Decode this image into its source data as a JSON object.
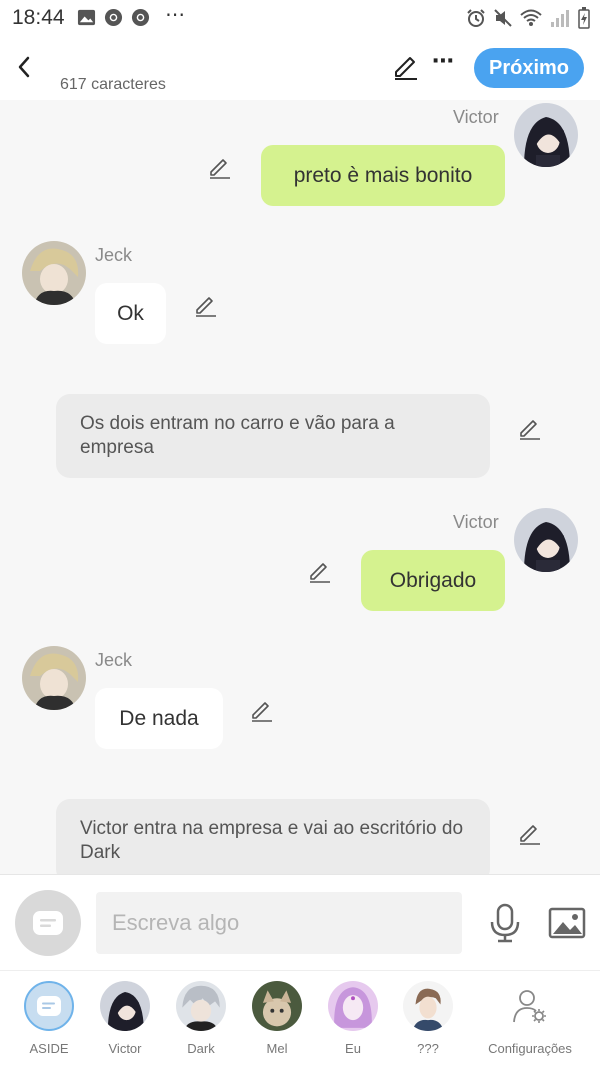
{
  "status_bar": {
    "time": "18:44",
    "more": "⋯"
  },
  "header": {
    "char_count": "617 caracteres",
    "next_label": "Próximo",
    "more": "⋯"
  },
  "messages": [
    {
      "type": "char",
      "side": "right",
      "name": "Victor",
      "text": "preto è mais bonito"
    },
    {
      "type": "char",
      "side": "left",
      "name": "Jeck",
      "text": "Ok"
    },
    {
      "type": "narration",
      "text": "Os dois entram no carro e vão para a empresa"
    },
    {
      "type": "char",
      "side": "right",
      "name": "Victor",
      "text": "Obrigado"
    },
    {
      "type": "char",
      "side": "left",
      "name": "Jeck",
      "text": "De nada"
    },
    {
      "type": "narration",
      "text": "Victor entra na empresa e vai ao escritório do Dark"
    }
  ],
  "input": {
    "placeholder": "Escreva algo"
  },
  "bottom_nav": [
    {
      "label": "ASIDE"
    },
    {
      "label": "Victor"
    },
    {
      "label": "Dark"
    },
    {
      "label": "Mel"
    },
    {
      "label": "Eu"
    },
    {
      "label": "???"
    },
    {
      "label": "Configurações"
    }
  ],
  "colors": {
    "accent": "#4aa3f0",
    "user_bubble": "#d5f28f",
    "narration_bg": "#ebebeb"
  }
}
